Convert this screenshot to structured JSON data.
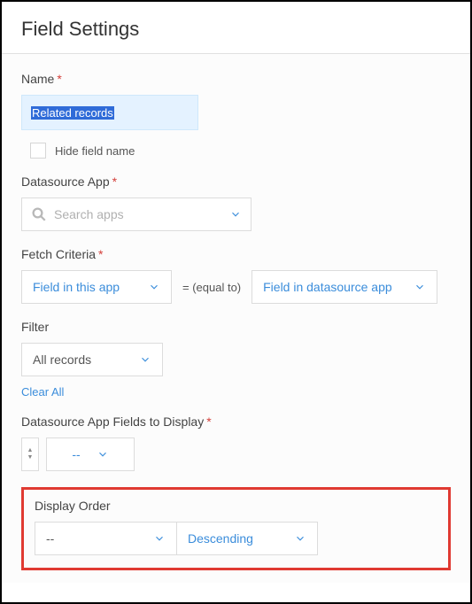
{
  "header": {
    "title": "Field Settings"
  },
  "name": {
    "label": "Name",
    "value": "Related records",
    "hide_checkbox_label": "Hide field name"
  },
  "datasource": {
    "label": "Datasource App",
    "placeholder": "Search apps"
  },
  "fetch": {
    "label": "Fetch Criteria",
    "left": "Field in this app",
    "op": "= (equal to)",
    "right": "Field in datasource app"
  },
  "filter": {
    "label": "Filter",
    "value": "All records",
    "clear": "Clear All"
  },
  "fields_display": {
    "label": "Datasource App Fields to Display",
    "value": "--"
  },
  "display_order": {
    "label": "Display Order",
    "field": "--",
    "direction": "Descending"
  }
}
